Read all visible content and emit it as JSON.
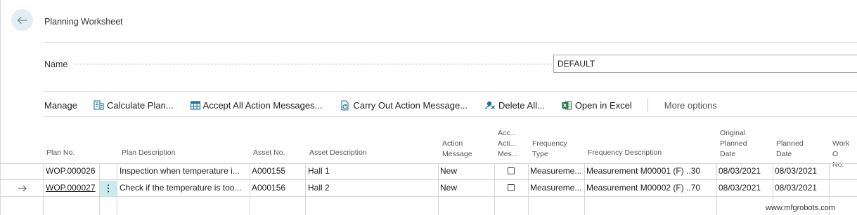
{
  "header": {
    "title": "Planning Worksheet"
  },
  "name_field": {
    "label": "Name",
    "value": "DEFAULT"
  },
  "actions": {
    "manage": "Manage",
    "calculate_plan": "Calculate Plan...",
    "accept_all": "Accept All Action Messages...",
    "carry_out": "Carry Out Action Message...",
    "delete_all": "Delete All...",
    "open_excel": "Open in Excel",
    "more_options": "More options"
  },
  "columns": {
    "plan_no": "Plan No.",
    "plan_description": "Plan Description",
    "asset_no": "Asset No.",
    "asset_description": "Asset Description",
    "action_message": [
      "Action",
      "Message"
    ],
    "accept_action_message": [
      "Acc...",
      "Acti...",
      "Mes..."
    ],
    "frequency_type": [
      "Frequency",
      "Type"
    ],
    "frequency_description": "Frequency Description",
    "original_planned_date": [
      "Original",
      "Planned",
      "Date"
    ],
    "planned_date": [
      "Planned",
      "Date"
    ],
    "work_order_no": [
      "Work O",
      "No."
    ]
  },
  "rows": [
    {
      "plan_no": "WOP.000026",
      "plan_description": "Inspection when temperature i...",
      "asset_no": "A000155",
      "asset_description": "Hall 1",
      "action_message": "New",
      "accept": false,
      "frequency_type": "Measureme...",
      "frequency_description": "Measurement M00001 (F) ..30",
      "original_planned_date": "08/03/2021",
      "planned_date": "08/03/2021"
    },
    {
      "plan_no": "WOP.000027",
      "plan_description": "Check if the temperature is too...",
      "asset_no": "A000156",
      "asset_description": "Hall 2",
      "action_message": "New",
      "accept": false,
      "frequency_type": "Measureme...",
      "frequency_description": "Measurement M00002 (F) ..70",
      "original_planned_date": "08/03/2021",
      "planned_date": "08/03/2021"
    }
  ],
  "watermark": "www.mfgrobots.com",
  "colors": {
    "accent": "#00a2b0",
    "back_circle": "#e3eef4",
    "selected_cell": "#c8ecee",
    "excel_green": "#1d7044"
  }
}
